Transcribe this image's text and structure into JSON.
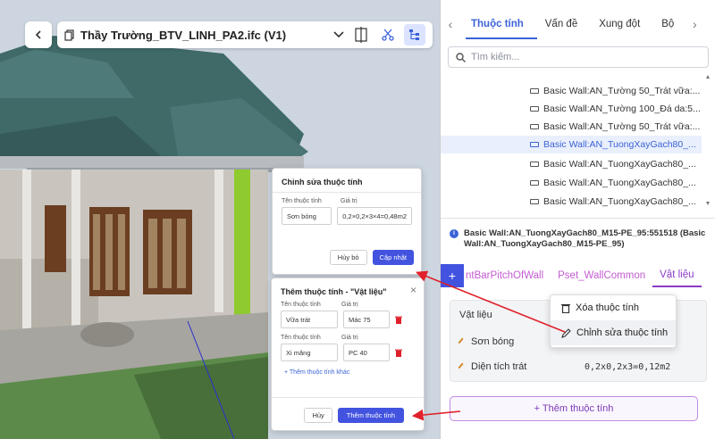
{
  "viewer": {
    "file_name": "Thầy Trường_BTV_LINH_PA2.ifc (V1)",
    "icons": [
      "chevron-left-icon",
      "copy-icon",
      "chevron-down-icon",
      "section-box-icon",
      "scissors-icon",
      "tree-icon"
    ]
  },
  "edit_dialog": {
    "title": "Chỉnh sửa thuộc tính",
    "name_label": "Tên thuộc tính",
    "value_label": "Giá trị",
    "name_value": "Sơn bóng",
    "value_value": "0,2×0,2×3×4=0,48m2",
    "cancel": "Hủy bỏ",
    "update": "Cập nhật"
  },
  "add_dialog": {
    "title": "Thêm thuộc tính - \"Vật liệu\"",
    "rows": [
      {
        "name_label": "Tên thuộc tính",
        "value_label": "Giá trị",
        "name": "Vữa trát",
        "value": "Mác 75"
      },
      {
        "name_label": "Tên thuộc tính",
        "value_label": "Giá trị",
        "name": "Xi măng",
        "value": "PC 40"
      }
    ],
    "add_more": "+ Thêm thuộc tính khác",
    "cancel": "Hủy",
    "submit": "Thêm thuộc tính"
  },
  "panel": {
    "tabs": [
      "Thuộc tính",
      "Vấn đề",
      "Xung đột",
      "Bộ"
    ],
    "search_placeholder": "Tìm kiếm...",
    "tree_items": [
      "Basic Wall:AN_Tường 50_Trát vữa:...",
      "Basic Wall:AN_Tường 100_Đá da:5...",
      "Basic Wall:AN_Tường 50_Trát vữa:...",
      "Basic Wall:AN_TuongXayGach80_...",
      "Basic Wall:AN_TuongXayGach80_...",
      "Basic Wall:AN_TuongXayGach80_...",
      "Basic Wall:AN_TuongXayGach80_..."
    ],
    "selected_index": 3,
    "element_info": "Basic Wall:AN_TuongXayGach80_M15-PE_95:551518 (Basic Wall:AN_TuongXayGach80_M15-PE_95)",
    "psets": [
      "ntBarPitchOfWall",
      "Pset_WallCommon",
      "Vật liệu"
    ],
    "active_pset": 2,
    "table_header": "Vật liệu",
    "properties": [
      {
        "name": "Sơn bóng",
        "value": ""
      },
      {
        "name": "Diện tích trát",
        "value": "0,2x0,2x3=0,12m2"
      }
    ],
    "context_menu": [
      "Xóa thuộc tính",
      "Chỉnh sửa thuộc tính"
    ],
    "add_property_button": "+ Thêm thuộc tính"
  },
  "colors": {
    "accent": "#3b63d8",
    "primary_button": "#4253e0",
    "pset_text": "#c35bd0",
    "arrow": "#e0212b"
  }
}
